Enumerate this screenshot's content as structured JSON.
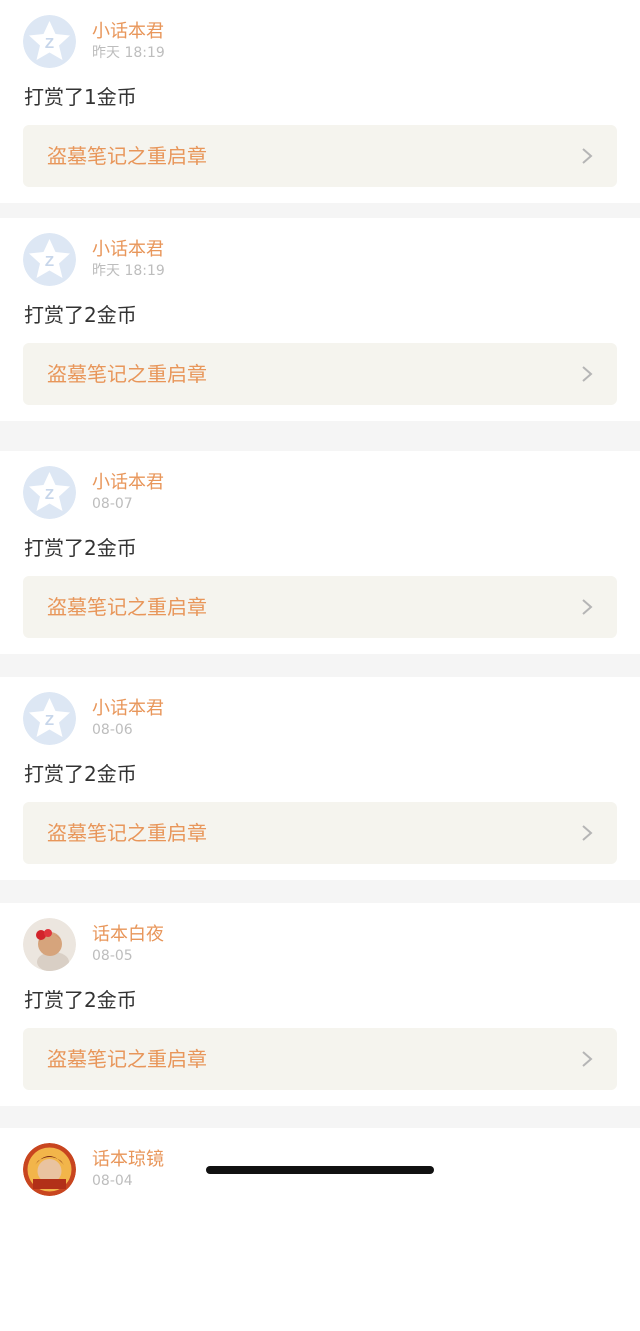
{
  "colors": {
    "accent": "#e8965a",
    "background": "#f5f5f5",
    "card_link_bg": "#f5f4ee",
    "muted": "#bdbdbd",
    "text": "#333333"
  },
  "feed": [
    {
      "user": "小话本君",
      "time": "昨天 18:19",
      "message": "打赏了1金币",
      "book": "盗墓笔记之重启章",
      "avatar_icon": "default-avatar-icon"
    },
    {
      "user": "小话本君",
      "time": "昨天 18:19",
      "message": "打赏了2金币",
      "book": "盗墓笔记之重启章",
      "avatar_icon": "default-avatar-icon"
    },
    {
      "user": "小话本君",
      "time": "08-07",
      "message": "打赏了2金币",
      "book": "盗墓笔记之重启章",
      "avatar_icon": "default-avatar-icon"
    },
    {
      "user": "小话本君",
      "time": "08-06",
      "message": "打赏了2金币",
      "book": "盗墓笔记之重启章",
      "avatar_icon": "default-avatar-icon"
    },
    {
      "user": "话本白夜",
      "time": "08-05",
      "message": "打赏了2金币",
      "book": "盗墓笔记之重启章",
      "avatar_icon": "photo-avatar-icon"
    },
    {
      "user": "话本琼镜",
      "time": "08-04",
      "avatar_icon": "photo-avatar-icon"
    }
  ]
}
